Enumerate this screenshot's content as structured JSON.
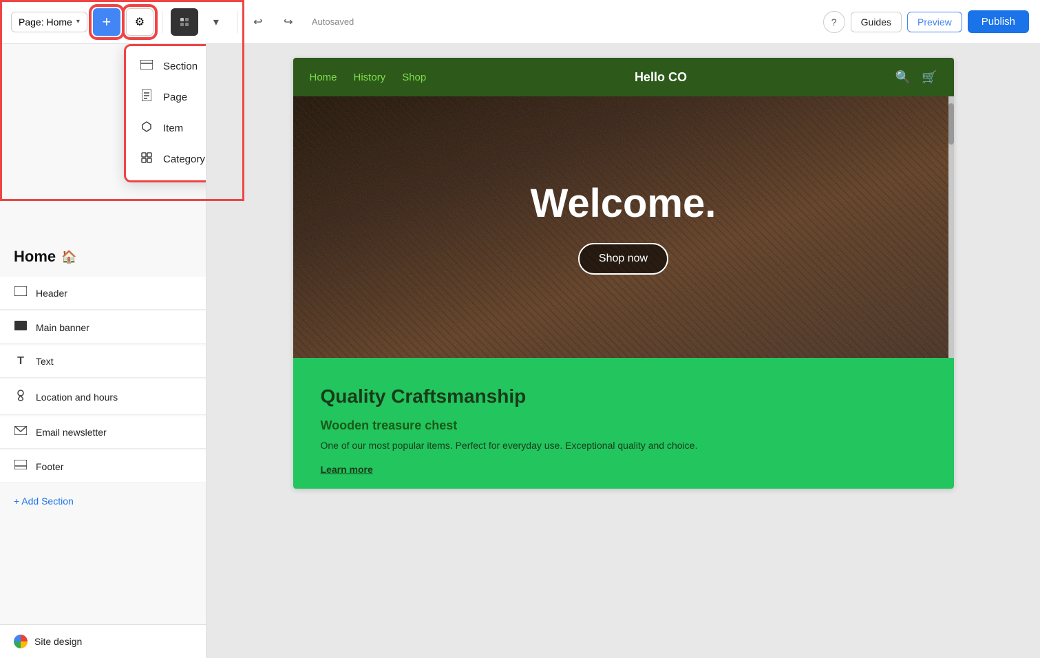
{
  "toolbar": {
    "page_label": "Page: Home",
    "autosaved": "Autosaved",
    "guides_label": "Guides",
    "preview_label": "Preview",
    "publish_label": "Publish",
    "help_icon": "?",
    "undo_icon": "↩",
    "redo_icon": "↪"
  },
  "dropdown": {
    "items": [
      {
        "id": "section",
        "label": "Section",
        "icon": "▭"
      },
      {
        "id": "page",
        "label": "Page",
        "icon": "▱"
      },
      {
        "id": "item",
        "label": "Item",
        "icon": "◇"
      },
      {
        "id": "category",
        "label": "Category",
        "icon": "▫"
      }
    ]
  },
  "sidebar": {
    "title": "Home",
    "home_icon": "🏠",
    "items": [
      {
        "id": "header",
        "label": "Header",
        "icon": "▭"
      },
      {
        "id": "main-banner",
        "label": "Main banner",
        "icon": "⬛"
      },
      {
        "id": "text",
        "label": "Text",
        "icon": "T"
      },
      {
        "id": "location-hours",
        "label": "Location and hours",
        "icon": "📍"
      },
      {
        "id": "email-newsletter",
        "label": "Email newsletter",
        "icon": "✉"
      },
      {
        "id": "footer",
        "label": "Footer",
        "icon": "▭"
      }
    ],
    "add_section_label": "+ Add Section",
    "site_design_label": "Site design"
  },
  "site_nav": {
    "links": [
      "Home",
      "History",
      "Shop"
    ],
    "brand": "Hello CO",
    "active_link": "Home"
  },
  "hero": {
    "title": "Welcome.",
    "cta_label": "Shop now"
  },
  "green_section": {
    "title": "Quality Craftsmanship",
    "product_title": "Wooden treasure chest",
    "product_desc": "One of our most popular items. Perfect for everyday use. Exceptional quality and choice.",
    "learn_more": "Learn more"
  }
}
